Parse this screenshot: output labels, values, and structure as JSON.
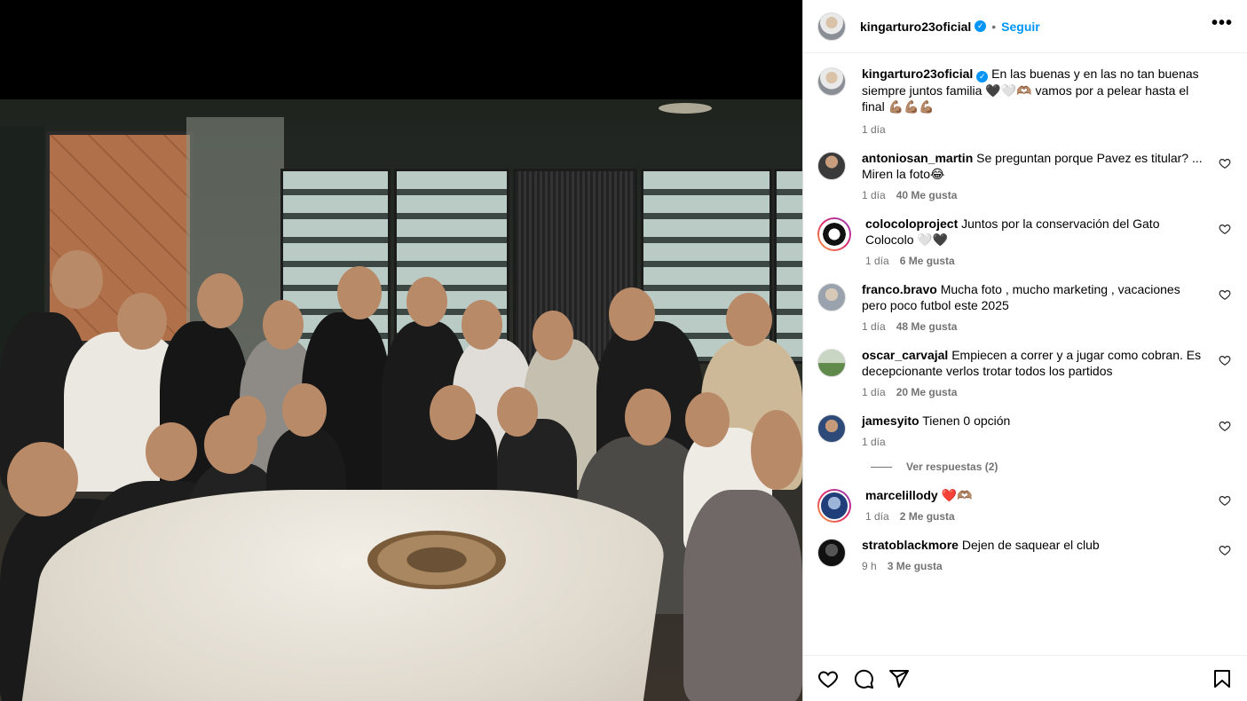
{
  "header": {
    "username": "kingarturo23oficial",
    "separator": "•",
    "follow_label": "Seguir",
    "more_label": "•••"
  },
  "caption": {
    "username": "kingarturo23oficial",
    "text": "En las buenas y en las no tan buenas siempre juntos familia 🖤🤍🫶🏽 vamos por a pelear hasta el final 💪🏽💪🏽💪🏽",
    "time": "1 día"
  },
  "comments": [
    {
      "username": "antoniosan_martin",
      "text": "Se preguntan porque Pavez es titular? ... Miren la foto😂",
      "time": "1 día",
      "likes": "40 Me gusta"
    },
    {
      "username": "colocoloproject",
      "text": "Juntos por la conservación del Gato Colocolo 🤍🖤",
      "time": "1 día",
      "likes": "6 Me gusta"
    },
    {
      "username": "franco.bravo",
      "text": "Mucha foto , mucho marketing , vacaciones pero poco futbol este 2025",
      "time": "1 día",
      "likes": "48 Me gusta"
    },
    {
      "username": "oscar_carvajal",
      "text": "Empiecen a correr y a jugar como cobran. Es decepcionante verlos trotar todos los partidos",
      "time": "1 día",
      "likes": "20 Me gusta"
    },
    {
      "username": "jamesyito",
      "text": "Tienen 0 opción",
      "time": "1 día",
      "likes": ""
    },
    {
      "username": "marcelillody",
      "text": "❤️🫶🏽",
      "time": "1 día",
      "likes": "2 Me gusta"
    },
    {
      "username": "stratoblackmore",
      "text": "Dejen de saquear el club",
      "time": "9 h",
      "likes": "3 Me gusta"
    }
  ],
  "replies_label": "Ver respuestas (2)",
  "icons": {
    "like": "heart-icon",
    "comment": "comment-icon",
    "share": "share-icon",
    "save": "bookmark-icon",
    "verified": "verified-badge-icon"
  },
  "colors": {
    "accent": "#0095f6",
    "muted": "#737373"
  }
}
